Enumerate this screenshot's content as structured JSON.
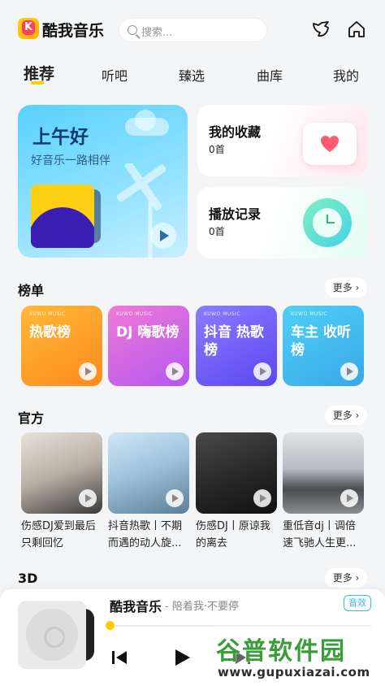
{
  "header": {
    "app_name": "酷我音乐",
    "search_placeholder": "搜索..."
  },
  "tabs": [
    {
      "label": "推荐",
      "active": true
    },
    {
      "label": "听吧",
      "active": false
    },
    {
      "label": "臻选",
      "active": false
    },
    {
      "label": "曲库",
      "active": false
    },
    {
      "label": "我的",
      "active": false
    }
  ],
  "hero": {
    "greeting": "上午好",
    "subtitle": "好音乐一路相伴"
  },
  "favorites": {
    "title": "我的收藏",
    "count": "0首"
  },
  "history": {
    "title": "播放记录",
    "count": "0首"
  },
  "sections": {
    "rankings": {
      "title": "榜单",
      "more": "更多 ›"
    },
    "official": {
      "title": "官方",
      "more": "更多 ›"
    },
    "three_d": {
      "title": "3D",
      "more": "更多 ›"
    }
  },
  "rank_tiles": [
    {
      "brand": "KUWO MUSIC",
      "name": "热歌榜",
      "color_from": "#ffb938",
      "color_to": "#ff8a1e"
    },
    {
      "brand": "KUWO MUSIC",
      "name": "DJ 嗨歌榜",
      "color_from": "#f07ad6",
      "color_to": "#b357f0"
    },
    {
      "brand": "KUWO MUSIC",
      "name": "抖音 热歌榜",
      "color_from": "#8a7cff",
      "color_to": "#5a48f0"
    },
    {
      "brand": "KUWO MUSIC",
      "name": "车主 收听榜",
      "color_from": "#4fd0f5",
      "color_to": "#3aa7e8"
    }
  ],
  "official_items": [
    {
      "caption": "伤感DJ爱到最后只剩回忆"
    },
    {
      "caption": "抖音热歌丨不期而遇的动人旋..."
    },
    {
      "caption": "伤感DJ丨原谅我的离去"
    },
    {
      "caption": "重低音dj丨调倍速飞驰人生更..."
    }
  ],
  "player": {
    "title": "酷我音乐",
    "subtitle": "- 陪着我·不要停",
    "effect_label": "音效",
    "progress": 0
  },
  "watermark": {
    "text": "谷普软件园",
    "url": "www.gupuxiazai.com"
  }
}
